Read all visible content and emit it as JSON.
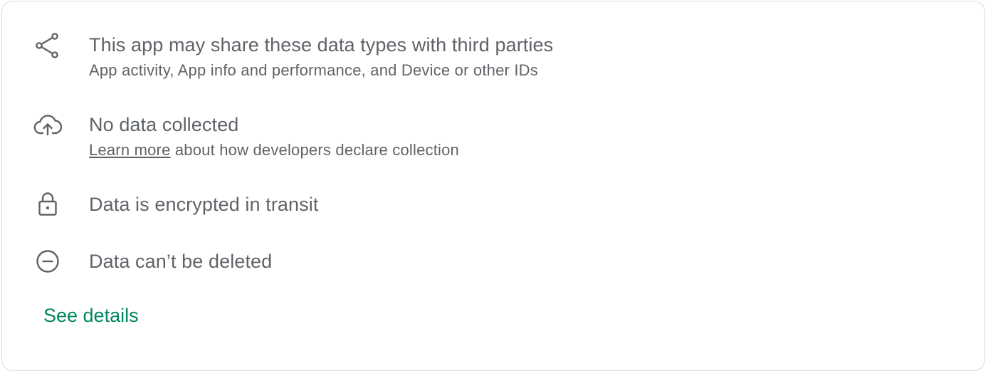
{
  "items": [
    {
      "icon": "share-icon",
      "title": "This app may share these data types with third parties",
      "subtitle": "App activity, App info and performance, and Device or other IDs"
    },
    {
      "icon": "cloud-upload-icon",
      "title": "No data collected",
      "subtitle_link": "Learn more",
      "subtitle_rest": " about how developers declare collection"
    },
    {
      "icon": "lock-icon",
      "title": "Data is encrypted in transit"
    },
    {
      "icon": "remove-circle-icon",
      "title": "Data can’t be deleted"
    }
  ],
  "see_details_label": "See details",
  "colors": {
    "text": "#5f6368",
    "accent": "#01875f",
    "border": "#dadce0"
  }
}
